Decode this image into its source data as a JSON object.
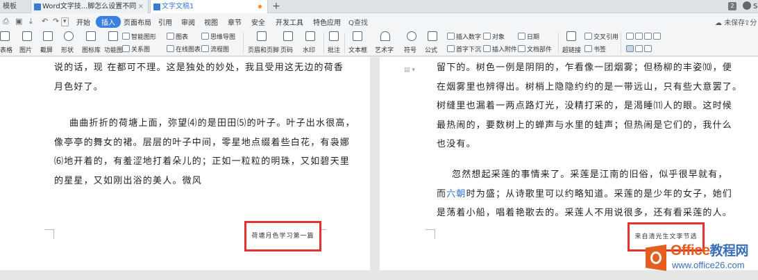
{
  "tabs": {
    "tab1": "模板",
    "tab2": "Word文字技...脚怎么设置不同",
    "tab3": "文字文稿1",
    "new_tab": "+",
    "count_badge": "2",
    "user_initial": "S"
  },
  "menu": {
    "items": [
      "开始",
      "插入",
      "页面布局",
      "引用",
      "审阅",
      "视图",
      "章节",
      "安全",
      "开发工具",
      "特色应用"
    ],
    "search": "Q查找",
    "unsaved": "未保存",
    "share": "分"
  },
  "ribbon": {
    "row1": {
      "smart_shape": "智能图形",
      "chart": "图表",
      "mindmap": "思维导图",
      "insert_number": "插入数字",
      "object": "对象",
      "date": "日期",
      "cross_ref": "交叉引用"
    },
    "row2": {
      "relation": "关系图",
      "online_chart": "在线图表",
      "flowchart": "流程图",
      "dropcap": "首字下沉",
      "attachment": "插入附件",
      "doc_parts": "文档部件",
      "bookmark": "书签"
    },
    "big": {
      "table": "表格",
      "picture": "图片",
      "screenshot": "截屏",
      "shape": "形状",
      "icon_lib": "图标库",
      "func_chart": "功能图",
      "header_footer": "页眉和页脚",
      "page_num": "页码",
      "watermark": "水印",
      "comment": "批注",
      "textbox": "文本框",
      "wordart": "艺术字",
      "symbol": "符号",
      "formula": "公式",
      "hyperlink": "超链接"
    }
  },
  "left_page": {
    "p1": [
      "说的话，现 在都可不理。这是独处的妙处，我且受用这无边的荷香",
      "月色好了。"
    ],
    "p2": [
      "曲曲折折的荷塘上面，弥望⑷的是田田⑸的叶子。叶子出水很高，",
      "像亭亭的舞女的裙。层层的叶子中间，零星地点缀着些白花，有袅娜",
      "⑹地开着的，有羞涩地打着朵儿的；正如一粒粒的明珠，又如碧天里",
      "的星星，又如刚出浴的美人。微风"
    ],
    "footer": "荷塘月色学习第一篇"
  },
  "right_page": {
    "p1": [
      "留下的。树色一例是阴阴的，乍看像一团烟雾；但杨柳的丰姿⑽，便",
      "在烟雾里也辨得出。树梢上隐隐约约的是一带远山，只有些大意罢了。",
      "树缝里也漏着一两点路灯光，没精打采的，是渴睡⑾人的眼。这时候",
      "最热闹的，要数树上的蝉声与水里的蛙声；但热闹是它们的，我什么",
      "也没有。"
    ],
    "p2_line1": "忽然想起采莲的事情来了。采莲是江南的旧俗，似乎很早就有，",
    "p2_line2_pre": "而",
    "p2_line2_hl": "六朝",
    "p2_line2_post": "时为盛；从诗歌里可以约略知道。采莲的是少年的女子，她们",
    "p2_line3": "是荡着小船，唱着艳歌去的。采莲人不用说很多，还有看采莲的人。",
    "footer": "来自清光生文李节选"
  },
  "watermark": {
    "title_en": "Office",
    "title_cn": "教程网",
    "url": "www.office26.com"
  },
  "colors": {
    "accent": "#3b82e0",
    "highlight_box": "#e5312f",
    "watermark_orange": "#e45f1f",
    "watermark_blue": "#3a6fb6"
  }
}
